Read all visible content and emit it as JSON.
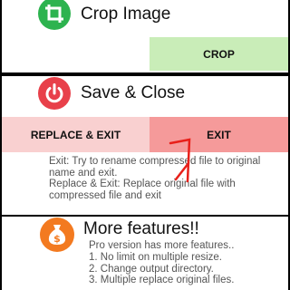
{
  "crop": {
    "title": "Crop Image",
    "button_label": "CROP",
    "icon": "crop-icon",
    "accent": "#2db34f"
  },
  "save": {
    "title": "Save & Close",
    "icon": "power-icon",
    "accent": "#e8404a",
    "replace_exit_label": "REPLACE & EXIT",
    "exit_label": "EXIT",
    "exit_desc": "Exit: Try to rename compressed file to original name and exit.",
    "replace_desc": "Replace & Exit: Replace original file with compressed file and exit"
  },
  "more": {
    "title": "More features!!",
    "icon": "money-bag-icon",
    "accent": "#f37a20",
    "pro_desc": "Pro version has more features..",
    "features": [
      "1. No limit on multiple resize.",
      "2. Change output directory.",
      "3. Multiple replace original files."
    ]
  }
}
